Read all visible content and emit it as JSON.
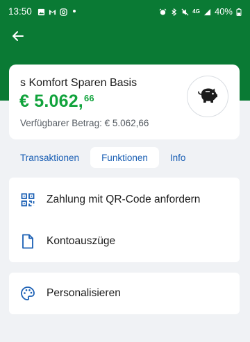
{
  "status_bar": {
    "time": "13:50",
    "battery": "40%",
    "network": "4G"
  },
  "header": {
    "back_icon": "arrow-left-icon"
  },
  "account": {
    "name": "s Komfort Sparen Basis",
    "balance_main": "€ 5.062,",
    "balance_cents": "66",
    "available_label": "Verfügbarer Betrag: € 5.062,66",
    "icon": "piggy-bank-icon"
  },
  "tabs": [
    {
      "label": "Transaktionen",
      "active": false
    },
    {
      "label": "Funktionen",
      "active": true
    },
    {
      "label": "Info",
      "active": false
    }
  ],
  "functions": [
    {
      "label": "Zahlung mit QR-Code anfordern",
      "icon": "qr-code-icon"
    },
    {
      "label": "Kontoauszüge",
      "icon": "document-icon"
    }
  ],
  "personalize": {
    "label": "Personalisieren",
    "icon": "palette-icon"
  },
  "colors": {
    "header_green": "#0a7a34",
    "balance_green": "#11a33c",
    "accent_blue": "#1a5fb4",
    "background": "#f0f2f5"
  }
}
